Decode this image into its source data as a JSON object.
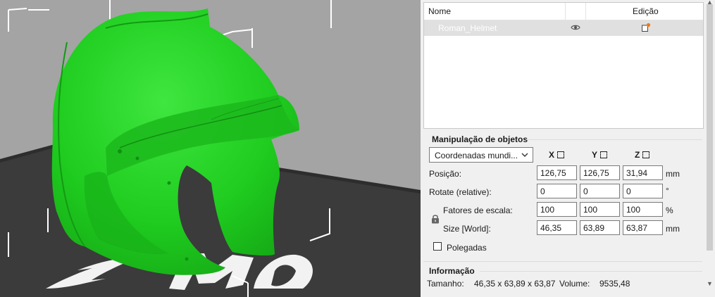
{
  "object_list": {
    "header_name": "Nome",
    "header_edit": "Edição",
    "rows": [
      {
        "name": "Roman_Helmet"
      }
    ]
  },
  "manipulation": {
    "title": "Manipulação de objetos",
    "coordinates_selected": "Coordenadas mundi...",
    "axes": [
      "X",
      "Y",
      "Z"
    ],
    "position": {
      "label": "Posição:",
      "x": "126,75",
      "y": "126,75",
      "z": "31,94",
      "unit": "mm"
    },
    "rotate": {
      "label": "Rotate (relative):",
      "x": "0",
      "y": "0",
      "z": "0",
      "unit": "°"
    },
    "scale": {
      "label": "Fatores de escala:",
      "x": "100",
      "y": "100",
      "z": "100",
      "unit": "%"
    },
    "size": {
      "label": "Size [World]:",
      "x": "46,35",
      "y": "63,89",
      "z": "63,87",
      "unit": "mm"
    },
    "inches_label": "Polegadas"
  },
  "info": {
    "title": "Informação",
    "size_label": "Tamanho:",
    "size_value": "46,35 x 63,89 x 63,87",
    "volume_label": "Volume:",
    "volume_value": "9535,48"
  },
  "colors": {
    "model": "#22cc22",
    "bed": "#3a3a3a",
    "viewport_bg": "#a4a4a4"
  }
}
